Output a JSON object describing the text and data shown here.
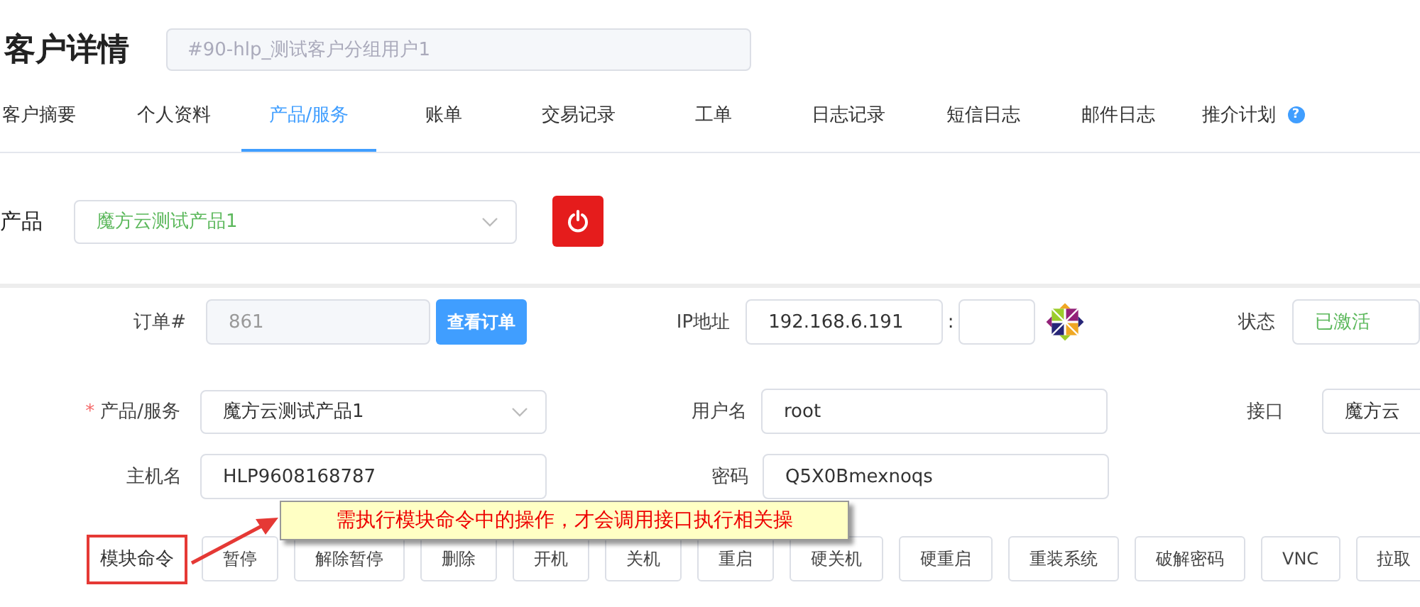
{
  "header": {
    "title": "客户详情",
    "search": {
      "placeholder": "#90-hlp_测试客户分组用户1"
    }
  },
  "tabs": [
    {
      "label": "客户摘要",
      "selected": false
    },
    {
      "label": "个人资料",
      "selected": false
    },
    {
      "label": "产品/服务",
      "selected": true
    },
    {
      "label": "账单",
      "selected": false
    },
    {
      "label": "交易记录",
      "selected": false
    },
    {
      "label": "工单",
      "selected": false
    },
    {
      "label": "日志记录",
      "selected": false
    },
    {
      "label": "短信日志",
      "selected": false
    },
    {
      "label": "邮件日志",
      "selected": false
    },
    {
      "label": "推介计划",
      "selected": false,
      "help": "?"
    }
  ],
  "product": {
    "label": "产品",
    "value": "魔方云测试产品1"
  },
  "form": {
    "order": {
      "label": "订单#",
      "value": "861",
      "button": "查看订单"
    },
    "ip": {
      "label": "IP地址",
      "value": "192.168.6.191",
      "separator": ":"
    },
    "status": {
      "label": "状态",
      "value": "已激活"
    },
    "service": {
      "label": "产品/服务",
      "required_mark": "*",
      "value": "魔方云测试产品1"
    },
    "username": {
      "label": "用户名",
      "value": "root"
    },
    "interface": {
      "label": "接口",
      "value": "魔方云"
    },
    "hostname": {
      "label": "主机名",
      "value": "HLP9608168787"
    },
    "password": {
      "label": "密码",
      "value": "Q5X0Bmexnoqs"
    },
    "module": {
      "label": "模块命令",
      "buttons": [
        "暂停",
        "解除暂停",
        "删除",
        "开机",
        "关机",
        "重启",
        "硬关机",
        "硬重启",
        "重装系统",
        "破解密码",
        "VNC",
        "拉取"
      ]
    }
  },
  "callout": {
    "text": "需执行模块命令中的操作，才会调用接口执行相关操"
  }
}
